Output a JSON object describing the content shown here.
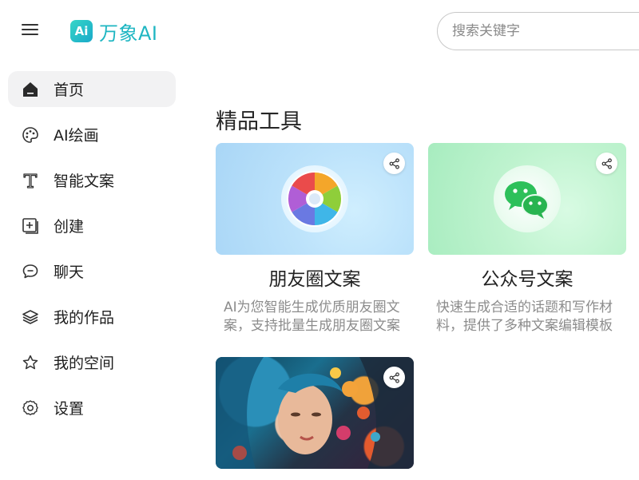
{
  "header": {
    "menu_icon": "hamburger-icon",
    "logo_badge": "Ai",
    "logo_text": "万象AI",
    "search_placeholder": "搜索关键字"
  },
  "sidebar": {
    "items": [
      {
        "label": "首页",
        "icon": "home-icon",
        "active": true
      },
      {
        "label": "AI绘画",
        "icon": "palette-icon"
      },
      {
        "label": "智能文案",
        "icon": "text-icon"
      },
      {
        "label": "创建",
        "icon": "add-square-icon"
      },
      {
        "label": "聊天",
        "icon": "chat-icon"
      },
      {
        "label": "我的作品",
        "icon": "layers-icon"
      },
      {
        "label": "我的空间",
        "icon": "star-icon"
      },
      {
        "label": "设置",
        "icon": "gear-icon"
      }
    ]
  },
  "main": {
    "section_title": "精品工具",
    "cards": [
      {
        "title": "朋友圈文案",
        "desc": "AI为您智能生成优质朋友圈文案，支持批量生成朋友圈文案",
        "icon": "aperture-icon"
      },
      {
        "title": "公众号文案",
        "desc": "快速生成合适的话题和写作材料，提供了多种文案编辑模板",
        "icon": "wechat-icon"
      },
      {
        "title": "",
        "desc": "",
        "icon": "art-portrait-image"
      }
    ]
  },
  "colors": {
    "brand": "#1fb6c2",
    "active_bg": "#f2f2f3",
    "muted_text": "#8c8c8c"
  }
}
